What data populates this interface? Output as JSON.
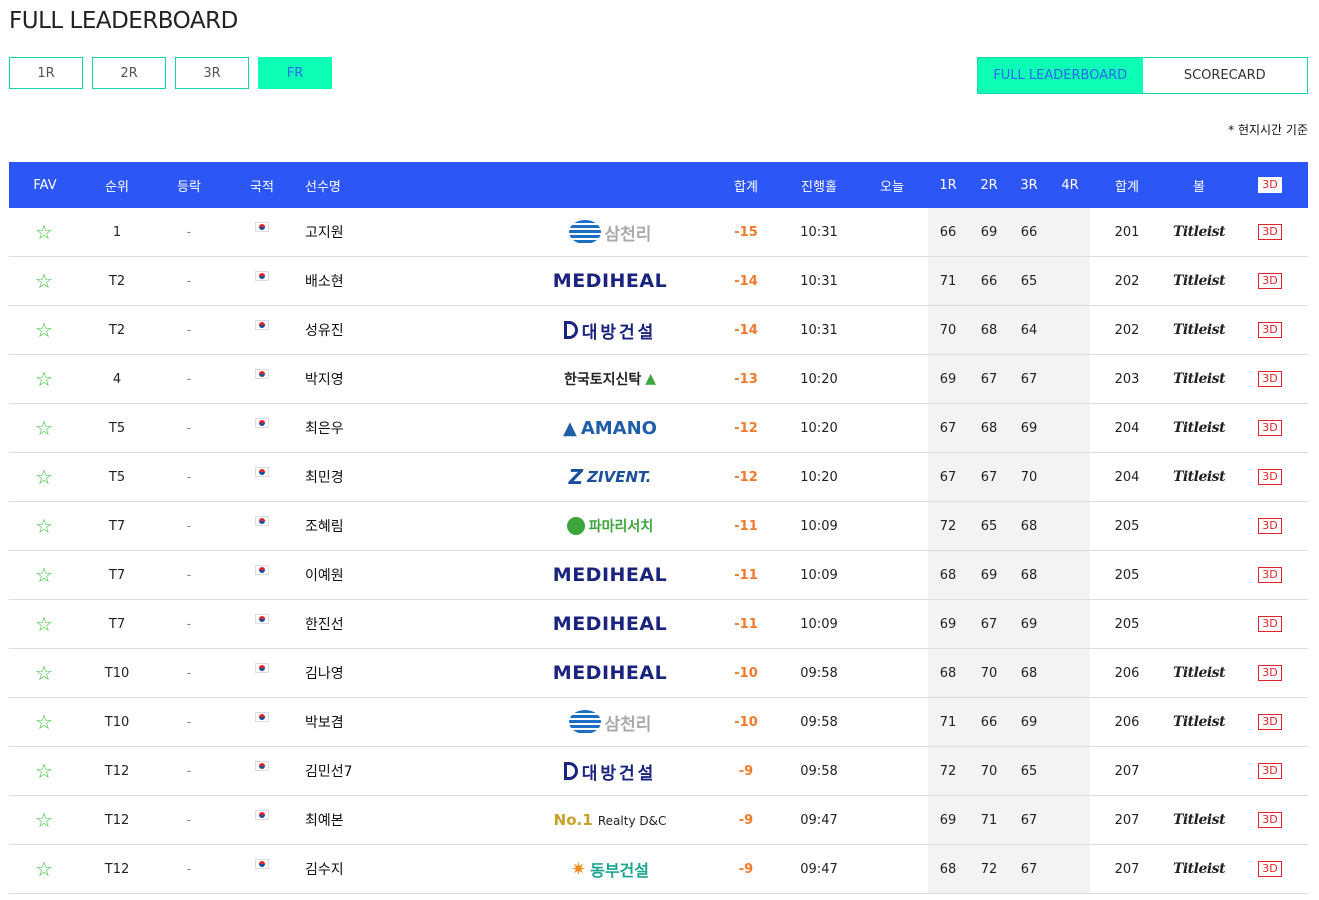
{
  "page": {
    "title": "FULL LEADERBOARD",
    "note": "* 현지시간 기준"
  },
  "round_tabs": [
    "1R",
    "2R",
    "3R",
    "FR"
  ],
  "view_toggle": {
    "leaderboard": "FULL LEADERBOARD",
    "scorecard": "SCORECARD"
  },
  "headers": {
    "fav": "FAV",
    "rank": "순위",
    "move": "등락",
    "nation": "국적",
    "player": "선수명",
    "total": "합계",
    "thru": "진행홀",
    "today": "오늘",
    "r1": "1R",
    "r2": "2R",
    "r3": "3R",
    "r4": "4R",
    "sum": "합계",
    "ball": "볼",
    "three_d": "3D"
  },
  "colors": {
    "header_bg": "#2c56f5",
    "accent": "#0dffb5",
    "score": "#f07a2a",
    "star": "#3ec43e"
  },
  "rows": [
    {
      "rank": "1",
      "move": "-",
      "name": "고지원",
      "sponsor": "삼천리",
      "sponsor_type": "samchully",
      "total": "-15",
      "thru": "10:31",
      "r1": "66",
      "r2": "69",
      "r3": "66",
      "sum": "201",
      "ball": "Titleist",
      "three_d": "3D"
    },
    {
      "rank": "T2",
      "move": "-",
      "name": "배소현",
      "sponsor": "MEDIHEAL",
      "sponsor_type": "mediheal",
      "total": "-14",
      "thru": "10:31",
      "r1": "71",
      "r2": "66",
      "r3": "65",
      "sum": "202",
      "ball": "Titleist",
      "three_d": "3D"
    },
    {
      "rank": "T2",
      "move": "-",
      "name": "성유진",
      "sponsor": "대방건설",
      "sponsor_type": "daebang",
      "total": "-14",
      "thru": "10:31",
      "r1": "70",
      "r2": "68",
      "r3": "64",
      "sum": "202",
      "ball": "Titleist",
      "three_d": "3D"
    },
    {
      "rank": "4",
      "move": "-",
      "name": "박지영",
      "sponsor": "한국토지신탁",
      "sponsor_type": "lt",
      "total": "-13",
      "thru": "10:20",
      "r1": "69",
      "r2": "67",
      "r3": "67",
      "sum": "203",
      "ball": "Titleist",
      "three_d": "3D"
    },
    {
      "rank": "T5",
      "move": "-",
      "name": "최은우",
      "sponsor": "AMANO",
      "sponsor_type": "amano",
      "total": "-12",
      "thru": "10:20",
      "r1": "67",
      "r2": "68",
      "r3": "69",
      "sum": "204",
      "ball": "Titleist",
      "three_d": "3D"
    },
    {
      "rank": "T5",
      "move": "-",
      "name": "최민경",
      "sponsor": "ZIVENT.",
      "sponsor_type": "zivent",
      "total": "-12",
      "thru": "10:20",
      "r1": "67",
      "r2": "67",
      "r3": "70",
      "sum": "204",
      "ball": "Titleist",
      "three_d": "3D"
    },
    {
      "rank": "T7",
      "move": "-",
      "name": "조혜림",
      "sponsor": "파마리서치",
      "sponsor_type": "pamari",
      "total": "-11",
      "thru": "10:09",
      "r1": "72",
      "r2": "65",
      "r3": "68",
      "sum": "205",
      "ball": "",
      "three_d": "3D"
    },
    {
      "rank": "T7",
      "move": "-",
      "name": "이예원",
      "sponsor": "MEDIHEAL",
      "sponsor_type": "mediheal",
      "total": "-11",
      "thru": "10:09",
      "r1": "68",
      "r2": "69",
      "r3": "68",
      "sum": "205",
      "ball": "",
      "three_d": "3D"
    },
    {
      "rank": "T7",
      "move": "-",
      "name": "한진선",
      "sponsor": "MEDIHEAL",
      "sponsor_type": "mediheal",
      "total": "-11",
      "thru": "10:09",
      "r1": "69",
      "r2": "67",
      "r3": "69",
      "sum": "205",
      "ball": "",
      "three_d": "3D"
    },
    {
      "rank": "T10",
      "move": "-",
      "name": "김나영",
      "sponsor": "MEDIHEAL",
      "sponsor_type": "mediheal",
      "total": "-10",
      "thru": "09:58",
      "r1": "68",
      "r2": "70",
      "r3": "68",
      "sum": "206",
      "ball": "Titleist",
      "three_d": "3D"
    },
    {
      "rank": "T10",
      "move": "-",
      "name": "박보겸",
      "sponsor": "삼천리",
      "sponsor_type": "samchully",
      "total": "-10",
      "thru": "09:58",
      "r1": "71",
      "r2": "66",
      "r3": "69",
      "sum": "206",
      "ball": "Titleist",
      "three_d": "3D"
    },
    {
      "rank": "T12",
      "move": "-",
      "name": "김민선7",
      "sponsor": "대방건설",
      "sponsor_type": "daebang",
      "total": "-9",
      "thru": "09:58",
      "r1": "72",
      "r2": "70",
      "r3": "65",
      "sum": "207",
      "ball": "",
      "three_d": "3D"
    },
    {
      "rank": "T12",
      "move": "-",
      "name": "최예본",
      "sponsor": "No.1 Realty D&C",
      "sponsor_type": "realty",
      "total": "-9",
      "thru": "09:47",
      "r1": "69",
      "r2": "71",
      "r3": "67",
      "sum": "207",
      "ball": "Titleist",
      "three_d": "3D"
    },
    {
      "rank": "T12",
      "move": "-",
      "name": "김수지",
      "sponsor": "동부건설",
      "sponsor_type": "dongbu",
      "total": "-9",
      "thru": "09:47",
      "r1": "68",
      "r2": "72",
      "r3": "67",
      "sum": "207",
      "ball": "Titleist",
      "three_d": "3D"
    }
  ]
}
